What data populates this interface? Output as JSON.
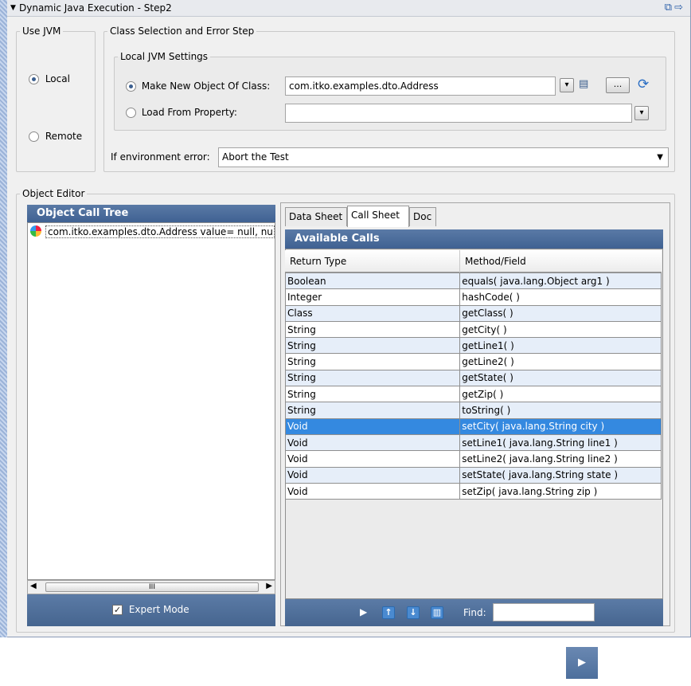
{
  "window": {
    "title": "Dynamic Java Execution - Step2"
  },
  "use_jvm": {
    "legend": "Use JVM",
    "local_label": "Local",
    "remote_label": "Remote",
    "selected": "Local"
  },
  "class_selection": {
    "legend": "Class Selection and Error Step",
    "local_settings_legend": "Local JVM Settings",
    "make_new_label": "Make New Object Of Class:",
    "make_new_value": "com.itko.examples.dto.Address",
    "load_from_label": "Load From Property:",
    "load_from_value": "",
    "env_error_label": "If environment error:",
    "env_error_value": "Abort the Test",
    "ellipsis_label": "...",
    "selected": "Make New Object Of Class"
  },
  "object_editor": {
    "legend": "Object Editor",
    "call_tree_title": "Object Call Tree",
    "tree_item": "com.itko.examples.dto.Address value=  null, nu",
    "expert_mode_label": "Expert Mode",
    "expert_mode_checked": true,
    "scroll_grip": "III"
  },
  "tabs": [
    {
      "label": "Data Sheet",
      "active": false
    },
    {
      "label": "Call Sheet",
      "active": true
    },
    {
      "label": "Doc",
      "active": false
    }
  ],
  "available_calls": {
    "title": "Available Calls",
    "columns": [
      "Return Type",
      "Method/Field"
    ],
    "rows": [
      {
        "type": "Boolean",
        "method": "equals( java.lang.Object arg1 )"
      },
      {
        "type": "Integer",
        "method": "hashCode( )"
      },
      {
        "type": "Class",
        "method": "getClass( )"
      },
      {
        "type": "String",
        "method": "getCity( )"
      },
      {
        "type": "String",
        "method": "getLine1( )"
      },
      {
        "type": "String",
        "method": "getLine2( )"
      },
      {
        "type": "String",
        "method": "getState( )"
      },
      {
        "type": "String",
        "method": "getZip( )"
      },
      {
        "type": "String",
        "method": "toString( )"
      },
      {
        "type": "Void",
        "method": "setCity( java.lang.String city )"
      },
      {
        "type": "Void",
        "method": "setLine1( java.lang.String line1 )"
      },
      {
        "type": "Void",
        "method": "setLine2( java.lang.String line2 )"
      },
      {
        "type": "Void",
        "method": "setState( java.lang.String state )"
      },
      {
        "type": "Void",
        "method": "setZip( java.lang.String zip )"
      }
    ],
    "selected_row": 9,
    "find_label": "Find:",
    "find_value": ""
  },
  "icons": {
    "title_collapse": "triangle-down-icon",
    "title_right": [
      "expand-window-icon",
      "arrow-right-icon"
    ],
    "class_browse": "document-icon",
    "refresh": "refresh-icon",
    "play": "play-icon",
    "move_up": "arrow-up-icon",
    "move_down": "arrow-down-icon",
    "delete": "trash-icon",
    "bottom_next": "play-icon"
  },
  "colors": {
    "header_navy": "#4a6a98",
    "selection_blue": "#3489e0",
    "alt_row": "#e6eef9"
  }
}
